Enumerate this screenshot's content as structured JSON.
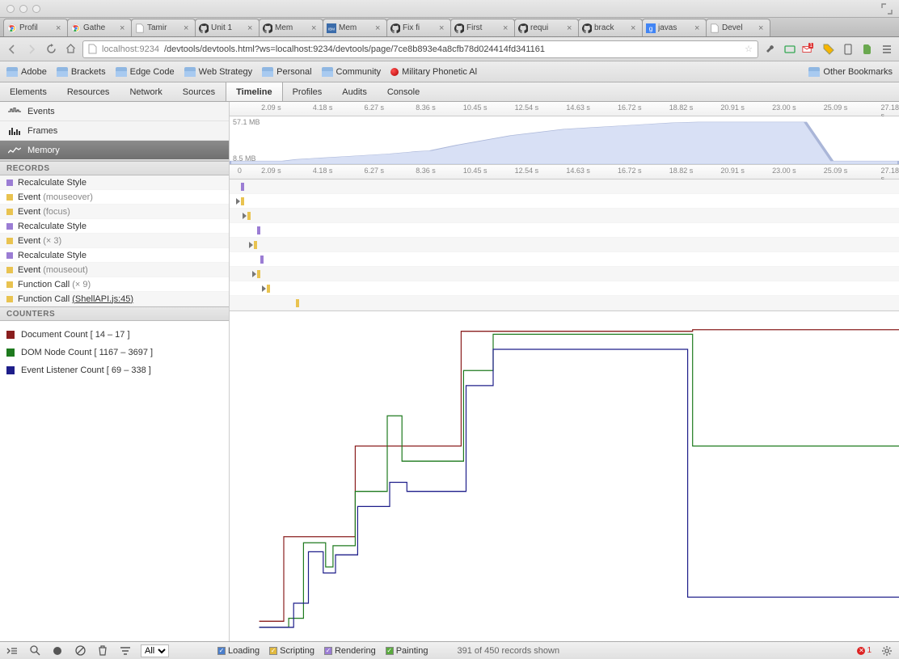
{
  "browser_tabs": [
    {
      "title": "Profil",
      "icon": "chrome"
    },
    {
      "title": "Gathe",
      "icon": "chrome"
    },
    {
      "title": "Tamir",
      "icon": "file"
    },
    {
      "title": "Unit 1",
      "icon": "github"
    },
    {
      "title": "Mem",
      "icon": "github"
    },
    {
      "title": "Mem",
      "icon": "ibm"
    },
    {
      "title": "Fix fi",
      "icon": "github"
    },
    {
      "title": "First",
      "icon": "github"
    },
    {
      "title": "requi",
      "icon": "github"
    },
    {
      "title": "brack",
      "icon": "github"
    },
    {
      "title": "javas",
      "icon": "google"
    },
    {
      "title": "Devel",
      "icon": "file"
    }
  ],
  "url": {
    "host": "localhost",
    "port": ":9234",
    "path": "/devtools/devtools.html?ws=localhost:9234/devtools/page/7ce8b893e4a8cfb78d024414fd341161"
  },
  "bookmarks": [
    "Adobe",
    "Brackets",
    "Edge Code",
    "Web Strategy",
    "Personal",
    "Community"
  ],
  "military_bookmark": "Military Phonetic Al",
  "other_bookmarks": "Other Bookmarks",
  "devtools_tabs": [
    "Elements",
    "Resources",
    "Network",
    "Sources",
    "Timeline",
    "Profiles",
    "Audits",
    "Console"
  ],
  "devtools_active": "Timeline",
  "left_tabs": [
    {
      "label": "Events",
      "icon": "events"
    },
    {
      "label": "Frames",
      "icon": "frames"
    },
    {
      "label": "Memory",
      "icon": "memory"
    }
  ],
  "left_active": "Memory",
  "ruler_top": [
    "2.09 s",
    "4.18 s",
    "6.27 s",
    "8.36 s",
    "10.45 s",
    "12.54 s",
    "14.63 s",
    "16.72 s",
    "18.82 s",
    "20.91 s",
    "23.00 s",
    "25.09 s",
    "27.18 s"
  ],
  "ruler_flame_prefix": "0",
  "overview": {
    "max": "57.1 MB",
    "min": "8.5 MB"
  },
  "records_header": "RECORDS",
  "records": [
    {
      "color": "purple",
      "text": "Recalculate Style",
      "sub": ""
    },
    {
      "color": "yellow",
      "text": "Event",
      "sub": "(mouseover)"
    },
    {
      "color": "yellow",
      "text": "Event",
      "sub": "(focus)"
    },
    {
      "color": "purple",
      "text": "Recalculate Style",
      "sub": ""
    },
    {
      "color": "yellow",
      "text": "Event",
      "sub": "(× 3)"
    },
    {
      "color": "purple",
      "text": "Recalculate Style",
      "sub": ""
    },
    {
      "color": "yellow",
      "text": "Event",
      "sub": "(mouseout)"
    },
    {
      "color": "yellow",
      "text": "Function Call",
      "sub": "(× 9)"
    },
    {
      "color": "yellow",
      "text": "Function Call",
      "sub": "(ShellAPI.js:45)",
      "link": true
    }
  ],
  "counters_header": "COUNTERS",
  "counters": [
    {
      "color": "dark-red",
      "label": "Document Count [ 14 – 17 ]"
    },
    {
      "color": "dark-green",
      "label": "DOM Node Count [ 1167 – 3697 ]"
    },
    {
      "color": "dark-blue",
      "label": "Event Listener Count [ 69 – 338 ]"
    }
  ],
  "flame_marks": [
    {
      "row": 0,
      "x": 14,
      "color": "#9b7dd4"
    },
    {
      "row": 1,
      "x": 14,
      "color": "#e9c350",
      "tri": 8
    },
    {
      "row": 2,
      "x": 22,
      "color": "#e9c350",
      "tri": 16
    },
    {
      "row": 3,
      "x": 34,
      "color": "#9b7dd4"
    },
    {
      "row": 4,
      "x": 30,
      "color": "#e9c350",
      "tri": 24
    },
    {
      "row": 5,
      "x": 38,
      "color": "#9b7dd4"
    },
    {
      "row": 6,
      "x": 34,
      "color": "#e9c350",
      "tri": 28
    },
    {
      "row": 7,
      "x": 46,
      "color": "#e9c350",
      "tri": 40
    },
    {
      "row": 8,
      "x": 82,
      "color": "#e9c350"
    }
  ],
  "chart_data": {
    "type": "line",
    "xlim": [
      0,
      27.18
    ],
    "title": "",
    "series": [
      {
        "name": "Document Count",
        "color": "#8a1e1e",
        "points": [
          [
            1.2,
            0.02
          ],
          [
            2.2,
            0.02
          ],
          [
            2.2,
            0.3
          ],
          [
            5.1,
            0.3
          ],
          [
            5.1,
            0.6
          ],
          [
            9.4,
            0.6
          ],
          [
            9.4,
            0.98
          ],
          [
            18.8,
            0.98
          ],
          [
            18.8,
            0.985
          ],
          [
            27.18,
            0.985
          ]
        ]
      },
      {
        "name": "DOM Node Count",
        "color": "#1e7a1e",
        "points": [
          [
            1.2,
            0.0
          ],
          [
            2.4,
            0.0
          ],
          [
            2.4,
            0.03
          ],
          [
            3.0,
            0.03
          ],
          [
            3.0,
            0.28
          ],
          [
            3.9,
            0.28
          ],
          [
            3.9,
            0.2
          ],
          [
            4.2,
            0.2
          ],
          [
            4.2,
            0.27
          ],
          [
            5.1,
            0.27
          ],
          [
            5.1,
            0.45
          ],
          [
            6.4,
            0.45
          ],
          [
            6.4,
            0.7
          ],
          [
            7.0,
            0.7
          ],
          [
            7.0,
            0.55
          ],
          [
            9.5,
            0.55
          ],
          [
            9.5,
            0.85
          ],
          [
            10.7,
            0.85
          ],
          [
            10.7,
            0.97
          ],
          [
            18.8,
            0.97
          ],
          [
            18.8,
            0.6
          ],
          [
            27.18,
            0.6
          ]
        ]
      },
      {
        "name": "Event Listener Count",
        "color": "#1e1e8a",
        "points": [
          [
            1.2,
            0.0
          ],
          [
            2.6,
            0.0
          ],
          [
            2.6,
            0.08
          ],
          [
            3.2,
            0.08
          ],
          [
            3.2,
            0.25
          ],
          [
            3.8,
            0.25
          ],
          [
            3.8,
            0.18
          ],
          [
            4.3,
            0.18
          ],
          [
            4.3,
            0.24
          ],
          [
            5.2,
            0.24
          ],
          [
            5.2,
            0.4
          ],
          [
            6.5,
            0.4
          ],
          [
            6.5,
            0.48
          ],
          [
            7.2,
            0.48
          ],
          [
            7.2,
            0.45
          ],
          [
            9.6,
            0.45
          ],
          [
            9.6,
            0.8
          ],
          [
            10.7,
            0.8
          ],
          [
            10.7,
            0.92
          ],
          [
            18.6,
            0.92
          ],
          [
            18.6,
            0.1
          ],
          [
            27.18,
            0.1
          ]
        ]
      }
    ]
  },
  "status": {
    "filter_label": "All",
    "legends": [
      {
        "cls": "blue",
        "label": "Loading"
      },
      {
        "cls": "yellow",
        "label": "Scripting"
      },
      {
        "cls": "purple",
        "label": "Rendering"
      },
      {
        "cls": "green",
        "label": "Painting"
      }
    ],
    "records_shown": "391 of 450 records shown",
    "errors": "1"
  }
}
